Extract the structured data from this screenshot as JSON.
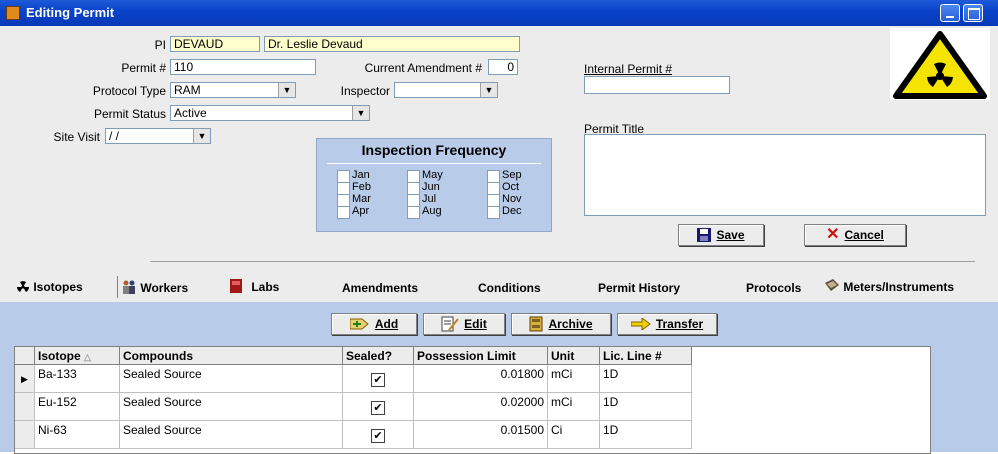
{
  "window": {
    "title": "Editing Permit"
  },
  "form": {
    "pi_label": "PI",
    "pi_code": "DEVAUD",
    "pi_name": "Dr. Leslie Devaud",
    "permit_label": "Permit #",
    "permit_value": "110",
    "amendment_label": "Current Amendment #",
    "amendment_value": "0",
    "protocol_label": "Protocol Type",
    "protocol_value": "RAM",
    "inspector_label": "Inspector",
    "inspector_value": "",
    "status_label": "Permit Status",
    "status_value": "Active",
    "site_visit_label": "Site Visit",
    "site_visit_value": "/ /",
    "internal_permit_label": "Internal Permit #",
    "internal_permit_value": "",
    "permit_title_label": "Permit Title",
    "permit_title_value": ""
  },
  "inspection": {
    "title": "Inspection Frequency",
    "months": [
      "Jan",
      "Feb",
      "Mar",
      "Apr",
      "May",
      "Jun",
      "Jul",
      "Aug",
      "Sep",
      "Oct",
      "Nov",
      "Dec"
    ]
  },
  "actions": {
    "save": "Save",
    "cancel": "Cancel"
  },
  "tabs": [
    "Isotopes",
    "Workers",
    "Labs",
    "Amendments",
    "Conditions",
    "Permit History",
    "Protocols",
    "Meters/Instruments"
  ],
  "toolbar": {
    "add": "Add",
    "edit": "Edit",
    "archive": "Archive",
    "transfer": "Transfer"
  },
  "grid": {
    "columns": [
      "Isotope",
      "Compounds",
      "Sealed?",
      "Possession Limit",
      "Unit",
      "Lic. Line #"
    ],
    "rows": [
      {
        "isotope": "Ba-133",
        "compound": "Sealed Source",
        "sealed": "✔",
        "limit": "0.01800",
        "unit": "mCi",
        "line": "1D"
      },
      {
        "isotope": "Eu-152",
        "compound": "Sealed Source",
        "sealed": "✔",
        "limit": "0.02000",
        "unit": "mCi",
        "line": "1D"
      },
      {
        "isotope": "Ni-63",
        "compound": "Sealed Source",
        "sealed": "✔",
        "limit": "0.01500",
        "unit": "Ci",
        "line": "1D"
      }
    ]
  },
  "colors": {
    "titlebar": "#0a43c8",
    "panel": "#ececec",
    "lower_panel": "#b8cbe8",
    "warning_yellow": "#f5e400",
    "cancel_red": "#d01010"
  },
  "icons": [
    "radiation-warning-icon",
    "save-icon",
    "cancel-icon",
    "add-icon",
    "edit-icon",
    "archive-icon",
    "transfer-icon",
    "isotopes-icon",
    "workers-icon",
    "labs-icon",
    "meters-icon",
    "sort-asc-icon",
    "row-pointer-icon",
    "dropdown-arrow-icon"
  ]
}
